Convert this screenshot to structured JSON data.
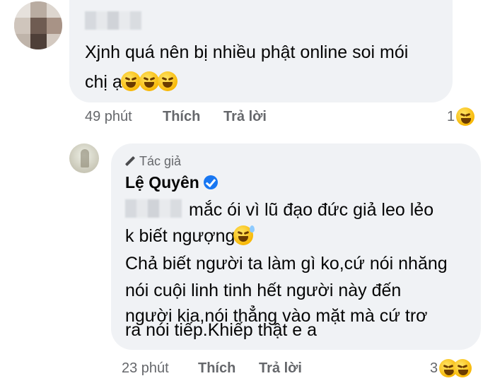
{
  "comment1": {
    "text_line1": "Xjnh quá nên bị nhiều phật online soi mói",
    "text_line2": "chị ạ",
    "time": "49 phút",
    "like_label": "Thích",
    "reply_label": "Trả lời",
    "reaction_count": "1",
    "emojis": [
      "rofl-icon",
      "rofl-icon",
      "rofl-icon"
    ],
    "reaction_emoji": "laughing-icon"
  },
  "comment2": {
    "badge_label": "Tác giả",
    "author_name": "Lệ Quyên",
    "text_line1": "mắc ói vì lũ đạo đức giả leo lẻo",
    "text_line2": "k biết ngượng",
    "text_line3": "Chả biết người ta làm gì ko,cứ nói nhăng",
    "text_line4": "nói cuội linh tinh hết người này đến",
    "text_line5": "người kia,nói thẳng vào mặt mà cứ trơ",
    "text_line6": "ra nói tiếp.Khiếp thật e a",
    "time": "23 phút",
    "like_label": "Thích",
    "reply_label": "Trả lời",
    "reaction_count": "3",
    "reaction_emoji": "laughing-icon",
    "inline_emoji": "sweat-smile-icon"
  },
  "colors": {
    "bubble_bg": "#f0f2f5",
    "meta_text": "#65676b",
    "verified_blue": "#1877f2"
  }
}
